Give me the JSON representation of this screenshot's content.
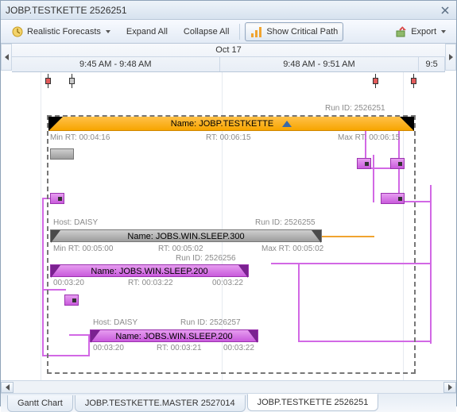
{
  "title": "JOBP.TESTKETTE 2526251",
  "toolbar": {
    "forecasts": "Realistic Forecasts",
    "expand": "Expand All",
    "collapse": "Collapse All",
    "critical": "Show Critical Path",
    "export": "Export"
  },
  "timeline": {
    "date": "Oct 17",
    "slot1": "9:45 AM - 9:48 AM",
    "slot2": "9:48 AM - 9:51 AM",
    "slot3": "9:5"
  },
  "outer": {
    "runid": "Run ID: 2526251",
    "name": "Name: JOBP.TESTKETTE",
    "minrt": "Min RT: 00:04:16",
    "rt": "RT: 00:06:15",
    "maxrt": "Max RT: 00:06:15"
  },
  "job1": {
    "host": "Host: DAISY",
    "runid": "Run ID: 2526255",
    "name": "Name: JOBS.WIN.SLEEP.300",
    "minrt": "Min RT: 00:05:00",
    "rt": "RT: 00:05:02",
    "maxrt": "Max RT: 00:05:02"
  },
  "job2": {
    "runid": "Run ID: 2526256",
    "name": "Name: JOBS.WIN.SLEEP.200",
    "t1": "00:03:20",
    "t2": "RT: 00:03:22",
    "t3": "00:03:22"
  },
  "job3": {
    "host": "Host: DAISY",
    "runid": "Run ID: 2526257",
    "name": "Name: JOBS.WIN.SLEEP.200",
    "t1": "00:03:20",
    "t2": "RT: 00:03:21",
    "t3": "00:03:22"
  },
  "tabs": {
    "t1": "Gantt Chart",
    "t2": "JOBP.TESTKETTE.MASTER 2527014",
    "t3": "JOBP.TESTKETTE 2526251"
  }
}
